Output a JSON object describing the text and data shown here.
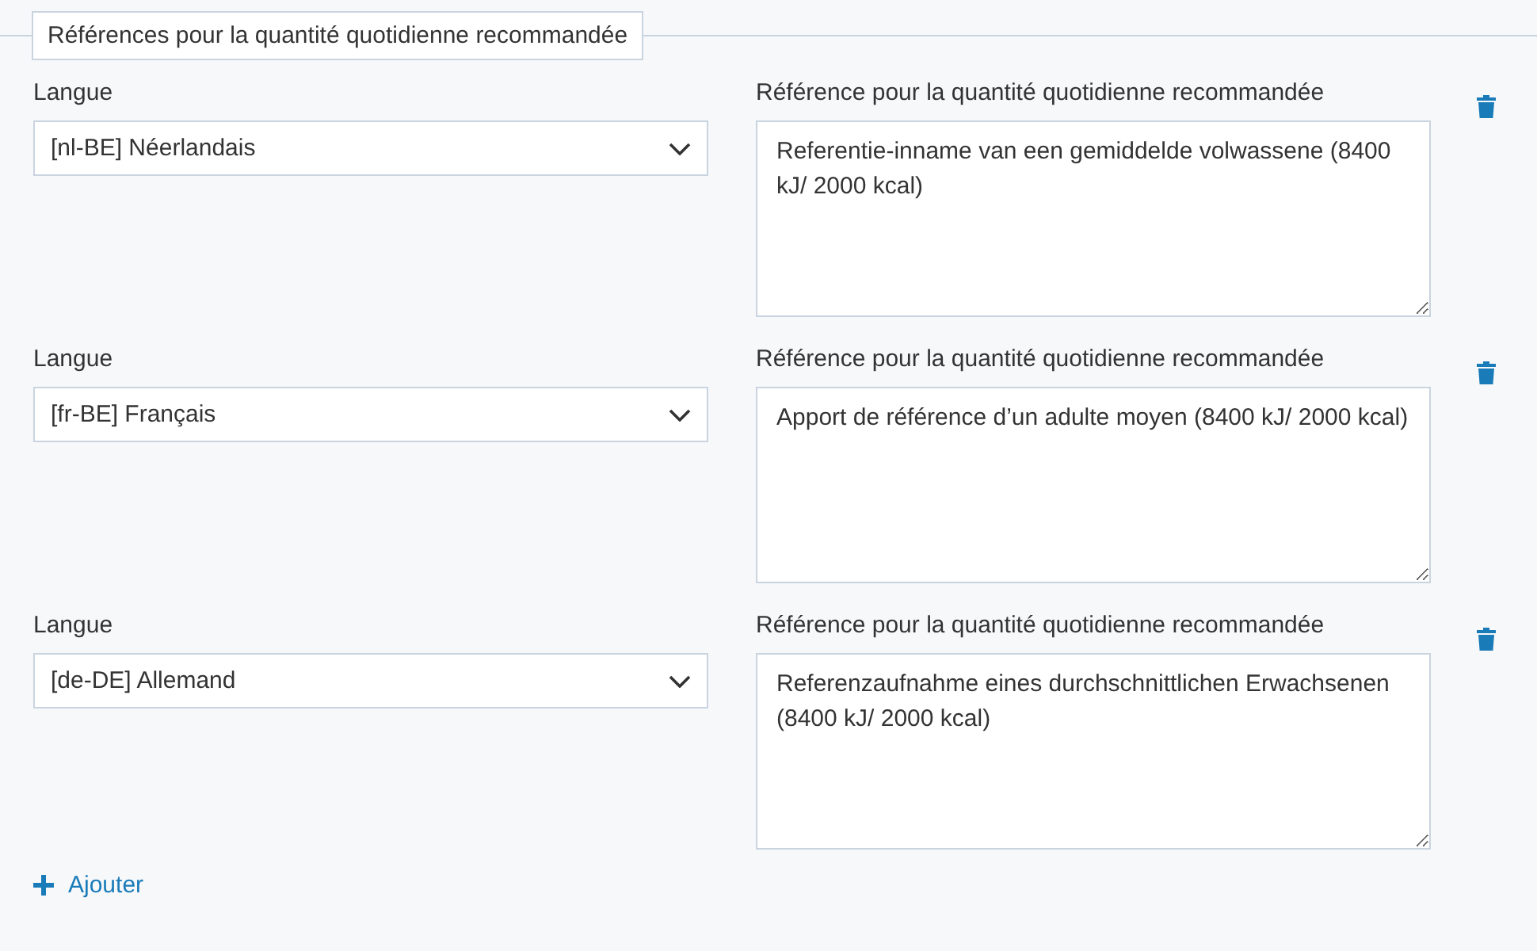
{
  "legend": "Références pour la quantité quotidienne recommandée",
  "rows": [
    {
      "language_label": "Langue",
      "language": "[nl-BE] Néerlandais",
      "reference_label": "Référence pour la quantité quotidienne recommandée",
      "reference": "Referentie-inname van een gemiddelde volwassene (8400 kJ/ 2000 kcal)"
    },
    {
      "language_label": "Langue",
      "language": "[fr-BE] Français",
      "reference_label": "Référence pour la quantité quotidienne recommandée",
      "reference": "Apport de référence d’un adulte moyen (8400 kJ/ 2000 kcal)"
    },
    {
      "language_label": "Langue",
      "language": "[de-DE] Allemand",
      "reference_label": "Référence pour la quantité quotidienne recommandée",
      "reference": "Referenzaufnahme eines durchschnittlichen Erwachsenen (8400 kJ/ 2000 kcal)"
    }
  ],
  "add_button": "Ajouter"
}
